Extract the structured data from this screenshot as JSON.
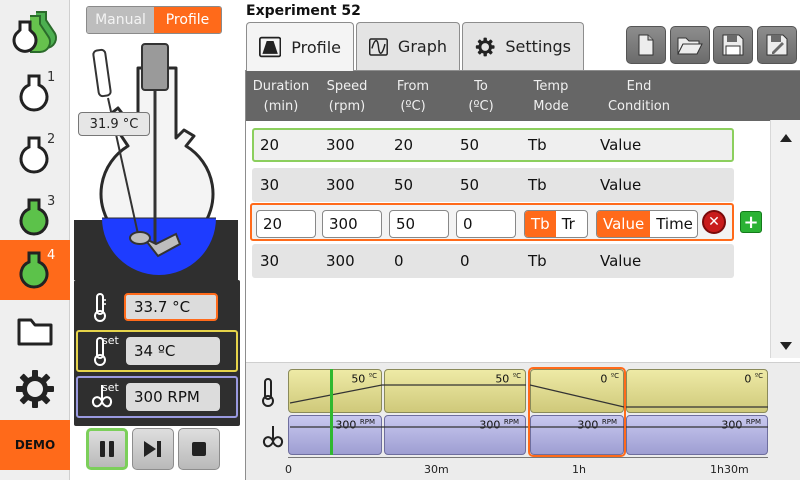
{
  "experiment_title": "Experiment 52",
  "mode_toggle": {
    "manual": "Manual",
    "profile": "Profile",
    "selected": "Profile"
  },
  "sidebar": {
    "items": [
      {
        "icon": "multi-flask-icon",
        "label": ""
      },
      {
        "icon": "flask-icon",
        "label": "1"
      },
      {
        "icon": "flask-icon",
        "label": "2"
      },
      {
        "icon": "flask-icon",
        "label": "3"
      },
      {
        "icon": "flask-icon",
        "label": "4",
        "active": true
      },
      {
        "icon": "folder-icon",
        "label": ""
      },
      {
        "icon": "gear-icon",
        "label": ""
      }
    ],
    "demo": "DEMO"
  },
  "reactor": {
    "probe_temp": "31.9 °C",
    "temperature": "33.7 °C",
    "setpoint_label": "set",
    "setpoint": "34 ºC",
    "speed_label": "set",
    "speed": "300 RPM"
  },
  "tabs": [
    {
      "label": "Profile",
      "icon": "profile-icon",
      "active": true
    },
    {
      "label": "Graph",
      "icon": "sine-wave-icon"
    },
    {
      "label": "Settings",
      "icon": "gear-icon"
    }
  ],
  "table": {
    "headers": [
      [
        "Duration",
        "(min)"
      ],
      [
        "Speed",
        "(rpm)"
      ],
      [
        "From",
        "(ºC)"
      ],
      [
        "To",
        "(ºC)"
      ],
      [
        "Temp",
        "Mode"
      ],
      [
        "End",
        "Condition"
      ]
    ],
    "rows": [
      {
        "duration": "20",
        "speed": "300",
        "from": "20",
        "to": "50",
        "mode": "Tb",
        "end": "Value",
        "state": "selected"
      },
      {
        "duration": "30",
        "speed": "300",
        "from": "50",
        "to": "50",
        "mode": "Tb",
        "end": "Value",
        "state": "normal"
      },
      {
        "duration": "20",
        "speed": "300",
        "from": "50",
        "to": "0",
        "mode": "Tb",
        "end": "Value",
        "state": "editing",
        "mode_options": [
          "Tb",
          "Tr"
        ],
        "end_options": [
          "Value",
          "Time"
        ]
      },
      {
        "duration": "30",
        "speed": "300",
        "from": "0",
        "to": "0",
        "mode": "Tb",
        "end": "Value",
        "state": "normal"
      }
    ]
  },
  "timeline": {
    "temp_segments": [
      {
        "label": "50",
        "unit": "ºC"
      },
      {
        "label": "50",
        "unit": "ºC"
      },
      {
        "label": "0",
        "unit": "ºC"
      },
      {
        "label": "0",
        "unit": "ºC"
      }
    ],
    "speed_segments": [
      {
        "label": "300",
        "unit": "RPM"
      },
      {
        "label": "300",
        "unit": "RPM"
      },
      {
        "label": "300",
        "unit": "RPM"
      },
      {
        "label": "300",
        "unit": "RPM"
      }
    ],
    "ticks": [
      "0",
      "30m",
      "1h",
      "1h30m"
    ]
  },
  "colors": {
    "accent": "#ff6a1a",
    "selected_row": "#8ccf5e",
    "liquid": "#1e3cff",
    "temp_band": "#e6e09a",
    "speed_band": "#b8b8e6"
  }
}
